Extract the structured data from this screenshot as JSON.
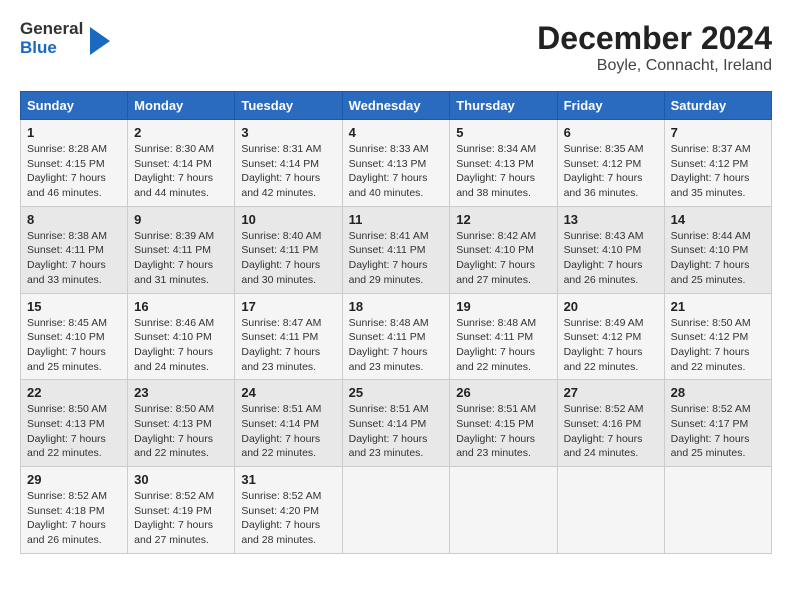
{
  "header": {
    "logo": {
      "line1": "General",
      "line2": "Blue"
    },
    "title": "December 2024",
    "subtitle": "Boyle, Connacht, Ireland"
  },
  "calendar": {
    "headers": [
      "Sunday",
      "Monday",
      "Tuesday",
      "Wednesday",
      "Thursday",
      "Friday",
      "Saturday"
    ],
    "rows": [
      [
        {
          "day": "1",
          "sunrise": "Sunrise: 8:28 AM",
          "sunset": "Sunset: 4:15 PM",
          "daylight": "Daylight: 7 hours",
          "extra": "and 46 minutes."
        },
        {
          "day": "2",
          "sunrise": "Sunrise: 8:30 AM",
          "sunset": "Sunset: 4:14 PM",
          "daylight": "Daylight: 7 hours",
          "extra": "and 44 minutes."
        },
        {
          "day": "3",
          "sunrise": "Sunrise: 8:31 AM",
          "sunset": "Sunset: 4:14 PM",
          "daylight": "Daylight: 7 hours",
          "extra": "and 42 minutes."
        },
        {
          "day": "4",
          "sunrise": "Sunrise: 8:33 AM",
          "sunset": "Sunset: 4:13 PM",
          "daylight": "Daylight: 7 hours",
          "extra": "and 40 minutes."
        },
        {
          "day": "5",
          "sunrise": "Sunrise: 8:34 AM",
          "sunset": "Sunset: 4:13 PM",
          "daylight": "Daylight: 7 hours",
          "extra": "and 38 minutes."
        },
        {
          "day": "6",
          "sunrise": "Sunrise: 8:35 AM",
          "sunset": "Sunset: 4:12 PM",
          "daylight": "Daylight: 7 hours",
          "extra": "and 36 minutes."
        },
        {
          "day": "7",
          "sunrise": "Sunrise: 8:37 AM",
          "sunset": "Sunset: 4:12 PM",
          "daylight": "Daylight: 7 hours",
          "extra": "and 35 minutes."
        }
      ],
      [
        {
          "day": "8",
          "sunrise": "Sunrise: 8:38 AM",
          "sunset": "Sunset: 4:11 PM",
          "daylight": "Daylight: 7 hours",
          "extra": "and 33 minutes."
        },
        {
          "day": "9",
          "sunrise": "Sunrise: 8:39 AM",
          "sunset": "Sunset: 4:11 PM",
          "daylight": "Daylight: 7 hours",
          "extra": "and 31 minutes."
        },
        {
          "day": "10",
          "sunrise": "Sunrise: 8:40 AM",
          "sunset": "Sunset: 4:11 PM",
          "daylight": "Daylight: 7 hours",
          "extra": "and 30 minutes."
        },
        {
          "day": "11",
          "sunrise": "Sunrise: 8:41 AM",
          "sunset": "Sunset: 4:11 PM",
          "daylight": "Daylight: 7 hours",
          "extra": "and 29 minutes."
        },
        {
          "day": "12",
          "sunrise": "Sunrise: 8:42 AM",
          "sunset": "Sunset: 4:10 PM",
          "daylight": "Daylight: 7 hours",
          "extra": "and 27 minutes."
        },
        {
          "day": "13",
          "sunrise": "Sunrise: 8:43 AM",
          "sunset": "Sunset: 4:10 PM",
          "daylight": "Daylight: 7 hours",
          "extra": "and 26 minutes."
        },
        {
          "day": "14",
          "sunrise": "Sunrise: 8:44 AM",
          "sunset": "Sunset: 4:10 PM",
          "daylight": "Daylight: 7 hours",
          "extra": "and 25 minutes."
        }
      ],
      [
        {
          "day": "15",
          "sunrise": "Sunrise: 8:45 AM",
          "sunset": "Sunset: 4:10 PM",
          "daylight": "Daylight: 7 hours",
          "extra": "and 25 minutes."
        },
        {
          "day": "16",
          "sunrise": "Sunrise: 8:46 AM",
          "sunset": "Sunset: 4:10 PM",
          "daylight": "Daylight: 7 hours",
          "extra": "and 24 minutes."
        },
        {
          "day": "17",
          "sunrise": "Sunrise: 8:47 AM",
          "sunset": "Sunset: 4:11 PM",
          "daylight": "Daylight: 7 hours",
          "extra": "and 23 minutes."
        },
        {
          "day": "18",
          "sunrise": "Sunrise: 8:48 AM",
          "sunset": "Sunset: 4:11 PM",
          "daylight": "Daylight: 7 hours",
          "extra": "and 23 minutes."
        },
        {
          "day": "19",
          "sunrise": "Sunrise: 8:48 AM",
          "sunset": "Sunset: 4:11 PM",
          "daylight": "Daylight: 7 hours",
          "extra": "and 22 minutes."
        },
        {
          "day": "20",
          "sunrise": "Sunrise: 8:49 AM",
          "sunset": "Sunset: 4:12 PM",
          "daylight": "Daylight: 7 hours",
          "extra": "and 22 minutes."
        },
        {
          "day": "21",
          "sunrise": "Sunrise: 8:50 AM",
          "sunset": "Sunset: 4:12 PM",
          "daylight": "Daylight: 7 hours",
          "extra": "and 22 minutes."
        }
      ],
      [
        {
          "day": "22",
          "sunrise": "Sunrise: 8:50 AM",
          "sunset": "Sunset: 4:13 PM",
          "daylight": "Daylight: 7 hours",
          "extra": "and 22 minutes."
        },
        {
          "day": "23",
          "sunrise": "Sunrise: 8:50 AM",
          "sunset": "Sunset: 4:13 PM",
          "daylight": "Daylight: 7 hours",
          "extra": "and 22 minutes."
        },
        {
          "day": "24",
          "sunrise": "Sunrise: 8:51 AM",
          "sunset": "Sunset: 4:14 PM",
          "daylight": "Daylight: 7 hours",
          "extra": "and 22 minutes."
        },
        {
          "day": "25",
          "sunrise": "Sunrise: 8:51 AM",
          "sunset": "Sunset: 4:14 PM",
          "daylight": "Daylight: 7 hours",
          "extra": "and 23 minutes."
        },
        {
          "day": "26",
          "sunrise": "Sunrise: 8:51 AM",
          "sunset": "Sunset: 4:15 PM",
          "daylight": "Daylight: 7 hours",
          "extra": "and 23 minutes."
        },
        {
          "day": "27",
          "sunrise": "Sunrise: 8:52 AM",
          "sunset": "Sunset: 4:16 PM",
          "daylight": "Daylight: 7 hours",
          "extra": "and 24 minutes."
        },
        {
          "day": "28",
          "sunrise": "Sunrise: 8:52 AM",
          "sunset": "Sunset: 4:17 PM",
          "daylight": "Daylight: 7 hours",
          "extra": "and 25 minutes."
        }
      ],
      [
        {
          "day": "29",
          "sunrise": "Sunrise: 8:52 AM",
          "sunset": "Sunset: 4:18 PM",
          "daylight": "Daylight: 7 hours",
          "extra": "and 26 minutes."
        },
        {
          "day": "30",
          "sunrise": "Sunrise: 8:52 AM",
          "sunset": "Sunset: 4:19 PM",
          "daylight": "Daylight: 7 hours",
          "extra": "and 27 minutes."
        },
        {
          "day": "31",
          "sunrise": "Sunrise: 8:52 AM",
          "sunset": "Sunset: 4:20 PM",
          "daylight": "Daylight: 7 hours",
          "extra": "and 28 minutes."
        },
        null,
        null,
        null,
        null
      ]
    ]
  }
}
